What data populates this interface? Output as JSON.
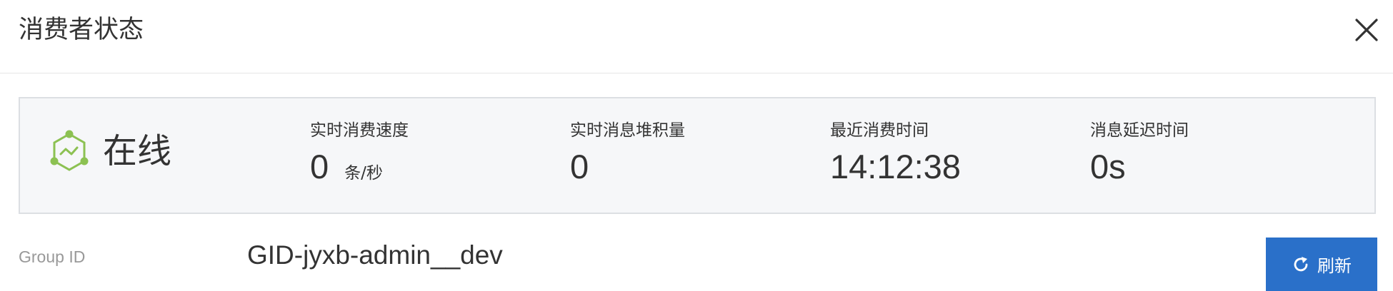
{
  "dialog": {
    "title": "消费者状态"
  },
  "status": {
    "state": "在线",
    "icon": "online-hexagon-icon",
    "accent_color": "#8cc152"
  },
  "metrics": [
    {
      "label": "实时消费速度",
      "value": "0",
      "unit": "条/秒"
    },
    {
      "label": "实时消息堆积量",
      "value": "0"
    },
    {
      "label": "最近消费时间",
      "value": "14:12:38"
    },
    {
      "label": "消息延迟时间",
      "value": "0s"
    }
  ],
  "group": {
    "label": "Group ID",
    "value": "GID-jyxb-admin__dev"
  },
  "actions": {
    "refresh_label": "刷新",
    "refresh_color": "#2a70c9"
  }
}
